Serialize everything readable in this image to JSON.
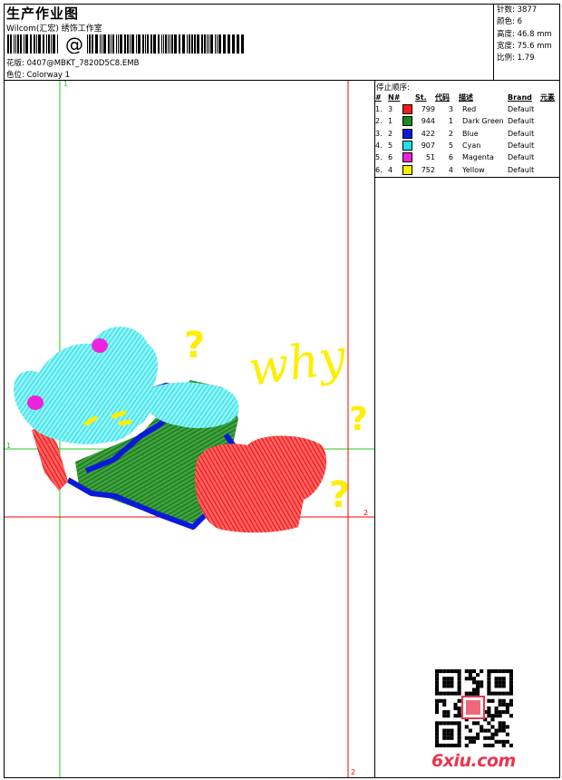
{
  "header": {
    "title": "生产作业图",
    "company": "Wilcom(汇宏) 绣饰工作室",
    "design_label": "花版:",
    "design_value": "0407@MBKT_7820D5C8.EMB",
    "colorway_label": "色位:",
    "colorway_value": "Colorway 1",
    "barcode_text": "@"
  },
  "stats": [
    {
      "label": "针数:",
      "value": "3877"
    },
    {
      "label": "颜色:",
      "value": "6"
    },
    {
      "label": "高度:",
      "value": "46.8 mm"
    },
    {
      "label": "宽度:",
      "value": "75.6 mm"
    },
    {
      "label": "比例:",
      "value": "1.79"
    }
  ],
  "sequence": {
    "label": "停止顺序:",
    "columns": [
      "#",
      "N#",
      "St.",
      "代码",
      "描述",
      "Brand",
      "元素"
    ],
    "rows": [
      {
        "idx": "1.",
        "n": "3",
        "color": "#ff1a1a",
        "st": "799",
        "code": "3",
        "desc": "Red",
        "brand": "Default"
      },
      {
        "idx": "2.",
        "n": "1",
        "color": "#1a8a1a",
        "st": "944",
        "code": "1",
        "desc": "Dark Green",
        "brand": "Default"
      },
      {
        "idx": "3.",
        "n": "2",
        "color": "#0a1ad8",
        "st": "422",
        "code": "2",
        "desc": "Blue",
        "brand": "Default"
      },
      {
        "idx": "4.",
        "n": "5",
        "color": "#22e0e6",
        "st": "907",
        "code": "5",
        "desc": "Cyan",
        "brand": "Default"
      },
      {
        "idx": "5.",
        "n": "6",
        "color": "#ee22dd",
        "st": "51",
        "code": "6",
        "desc": "Magenta",
        "brand": "Default"
      },
      {
        "idx": "6.",
        "n": "4",
        "color": "#ffee00",
        "st": "752",
        "code": "4",
        "desc": "Yellow",
        "brand": "Default"
      }
    ]
  },
  "guides": {
    "green_top": "1",
    "green_left": "1",
    "red_right": "2",
    "red_bottom": "2",
    "green_color": "#22cc22",
    "red_color": "#ff0000"
  },
  "embroidery": {
    "text": "why",
    "question_mark": "?",
    "colors": {
      "cyan": "#22dde6",
      "magenta": "#ee22dd",
      "red": "#ff1a1a",
      "green": "#1a8a1a",
      "blue": "#0a1ad8",
      "yellow": "#ffee00"
    }
  },
  "watermark": "6xiu.com",
  "qr_icon": "qr-code-icon"
}
